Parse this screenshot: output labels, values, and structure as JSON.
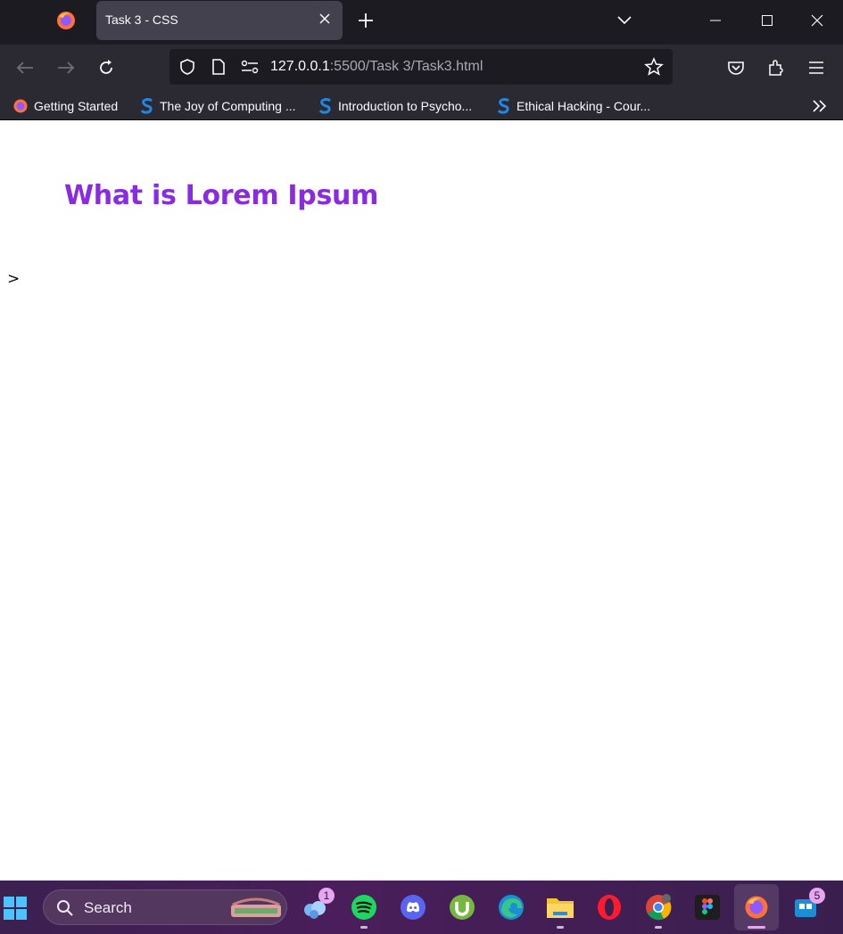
{
  "browser": {
    "tab_title": "Task 3 - CSS",
    "url_host": "127.0.0.1",
    "url_rest": ":5500/Task 3/Task3.html",
    "bookmarks": [
      {
        "label": "Getting Started",
        "icon": "firefox-icon"
      },
      {
        "label": "The Joy of Computing ...",
        "icon": "swayam-icon"
      },
      {
        "label": "Introduction to Psycho...",
        "icon": "swayam-icon"
      },
      {
        "label": "Ethical Hacking - Cour...",
        "icon": "swayam-icon"
      }
    ]
  },
  "page": {
    "heading": "What is Lorem Ipsum",
    "stray_text": ">"
  },
  "taskbar": {
    "search_label": "Search",
    "weather_badge": "1",
    "store_badge": "5"
  },
  "colors": {
    "heading": "#8a2be2",
    "tabbar": "#1c1b22",
    "toolbar": "#2b2a33"
  }
}
